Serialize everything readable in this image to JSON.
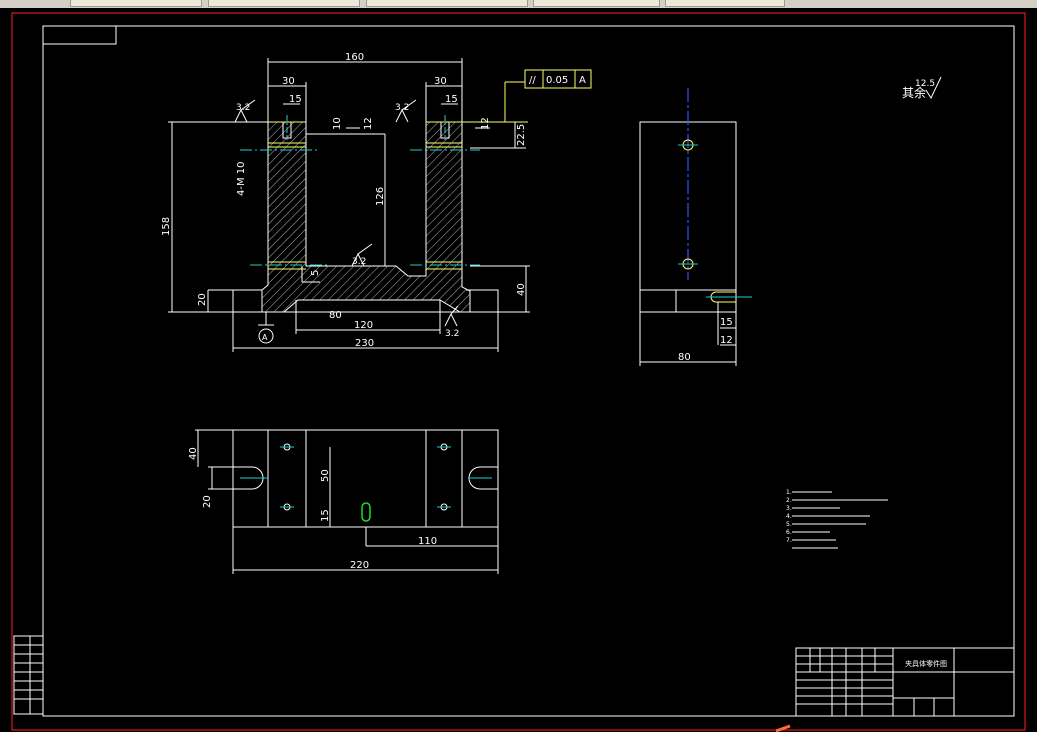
{
  "window": {
    "tabs": [
      "",
      "",
      "",
      "",
      "",
      ""
    ]
  },
  "drawing": {
    "dims": {
      "d160": "160",
      "d30a": "30",
      "d30b": "30",
      "d15a": "15",
      "d15b": "15",
      "d10": "10",
      "d12": "12",
      "d12b": "12",
      "d22_5": "22.5",
      "d4M10": "4-M 10",
      "d126": "126",
      "d158": "158",
      "d5": "5",
      "d20": "20",
      "d40": "40",
      "d80": "80",
      "d120": "120",
      "d230": "230",
      "dA": "A",
      "s32a": "3.2",
      "s32b": "3.2",
      "s32c": "3.2",
      "s32d": "3.2",
      "side80": "80",
      "side15": "15",
      "side12": "12",
      "p40": "40",
      "p20": "20",
      "p50": "50",
      "p15": "15",
      "p110": "110",
      "p220": "220"
    },
    "tolerance": {
      "symbol": "//",
      "value": "0.05",
      "datum": "A"
    },
    "rest": {
      "label": "其余",
      "value": "12.5"
    },
    "notes": [
      "1.",
      "2.",
      "3.",
      "4.",
      "5.",
      "6.",
      "7."
    ],
    "titleblock": {
      "title": "夹具体零件图",
      "code": ""
    }
  }
}
